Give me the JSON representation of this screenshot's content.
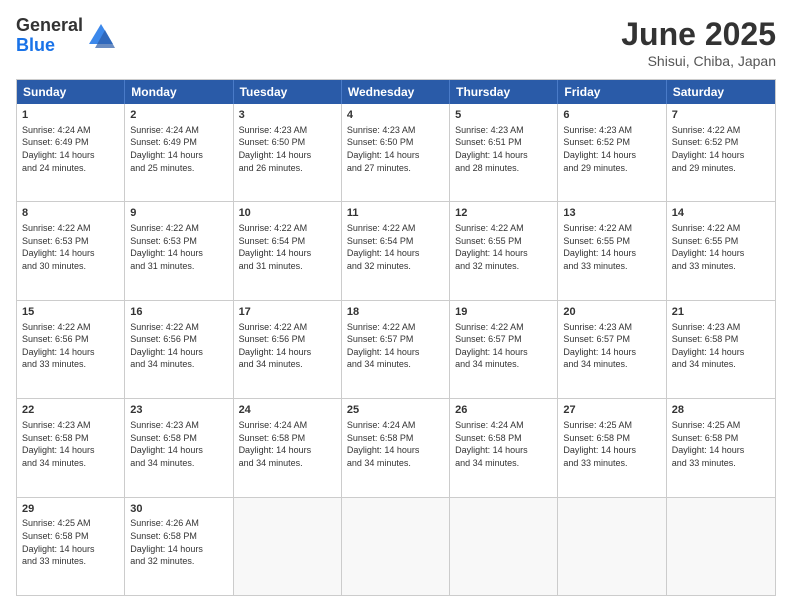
{
  "header": {
    "logo_general": "General",
    "logo_blue": "Blue",
    "month": "June 2025",
    "location": "Shisui, Chiba, Japan"
  },
  "weekdays": [
    "Sunday",
    "Monday",
    "Tuesday",
    "Wednesday",
    "Thursday",
    "Friday",
    "Saturday"
  ],
  "rows": [
    [
      {
        "day": "",
        "lines": [],
        "empty": true
      },
      {
        "day": "2",
        "lines": [
          "Sunrise: 4:24 AM",
          "Sunset: 6:49 PM",
          "Daylight: 14 hours",
          "and 25 minutes."
        ]
      },
      {
        "day": "3",
        "lines": [
          "Sunrise: 4:23 AM",
          "Sunset: 6:50 PM",
          "Daylight: 14 hours",
          "and 26 minutes."
        ]
      },
      {
        "day": "4",
        "lines": [
          "Sunrise: 4:23 AM",
          "Sunset: 6:50 PM",
          "Daylight: 14 hours",
          "and 27 minutes."
        ]
      },
      {
        "day": "5",
        "lines": [
          "Sunrise: 4:23 AM",
          "Sunset: 6:51 PM",
          "Daylight: 14 hours",
          "and 28 minutes."
        ]
      },
      {
        "day": "6",
        "lines": [
          "Sunrise: 4:23 AM",
          "Sunset: 6:52 PM",
          "Daylight: 14 hours",
          "and 29 minutes."
        ]
      },
      {
        "day": "7",
        "lines": [
          "Sunrise: 4:22 AM",
          "Sunset: 6:52 PM",
          "Daylight: 14 hours",
          "and 29 minutes."
        ]
      }
    ],
    [
      {
        "day": "8",
        "lines": [
          "Sunrise: 4:22 AM",
          "Sunset: 6:53 PM",
          "Daylight: 14 hours",
          "and 30 minutes."
        ]
      },
      {
        "day": "9",
        "lines": [
          "Sunrise: 4:22 AM",
          "Sunset: 6:53 PM",
          "Daylight: 14 hours",
          "and 31 minutes."
        ]
      },
      {
        "day": "10",
        "lines": [
          "Sunrise: 4:22 AM",
          "Sunset: 6:54 PM",
          "Daylight: 14 hours",
          "and 31 minutes."
        ]
      },
      {
        "day": "11",
        "lines": [
          "Sunrise: 4:22 AM",
          "Sunset: 6:54 PM",
          "Daylight: 14 hours",
          "and 32 minutes."
        ]
      },
      {
        "day": "12",
        "lines": [
          "Sunrise: 4:22 AM",
          "Sunset: 6:55 PM",
          "Daylight: 14 hours",
          "and 32 minutes."
        ]
      },
      {
        "day": "13",
        "lines": [
          "Sunrise: 4:22 AM",
          "Sunset: 6:55 PM",
          "Daylight: 14 hours",
          "and 33 minutes."
        ]
      },
      {
        "day": "14",
        "lines": [
          "Sunrise: 4:22 AM",
          "Sunset: 6:55 PM",
          "Daylight: 14 hours",
          "and 33 minutes."
        ]
      }
    ],
    [
      {
        "day": "15",
        "lines": [
          "Sunrise: 4:22 AM",
          "Sunset: 6:56 PM",
          "Daylight: 14 hours",
          "and 33 minutes."
        ]
      },
      {
        "day": "16",
        "lines": [
          "Sunrise: 4:22 AM",
          "Sunset: 6:56 PM",
          "Daylight: 14 hours",
          "and 34 minutes."
        ]
      },
      {
        "day": "17",
        "lines": [
          "Sunrise: 4:22 AM",
          "Sunset: 6:56 PM",
          "Daylight: 14 hours",
          "and 34 minutes."
        ]
      },
      {
        "day": "18",
        "lines": [
          "Sunrise: 4:22 AM",
          "Sunset: 6:57 PM",
          "Daylight: 14 hours",
          "and 34 minutes."
        ]
      },
      {
        "day": "19",
        "lines": [
          "Sunrise: 4:22 AM",
          "Sunset: 6:57 PM",
          "Daylight: 14 hours",
          "and 34 minutes."
        ]
      },
      {
        "day": "20",
        "lines": [
          "Sunrise: 4:23 AM",
          "Sunset: 6:57 PM",
          "Daylight: 14 hours",
          "and 34 minutes."
        ]
      },
      {
        "day": "21",
        "lines": [
          "Sunrise: 4:23 AM",
          "Sunset: 6:58 PM",
          "Daylight: 14 hours",
          "and 34 minutes."
        ]
      }
    ],
    [
      {
        "day": "22",
        "lines": [
          "Sunrise: 4:23 AM",
          "Sunset: 6:58 PM",
          "Daylight: 14 hours",
          "and 34 minutes."
        ]
      },
      {
        "day": "23",
        "lines": [
          "Sunrise: 4:23 AM",
          "Sunset: 6:58 PM",
          "Daylight: 14 hours",
          "and 34 minutes."
        ]
      },
      {
        "day": "24",
        "lines": [
          "Sunrise: 4:24 AM",
          "Sunset: 6:58 PM",
          "Daylight: 14 hours",
          "and 34 minutes."
        ]
      },
      {
        "day": "25",
        "lines": [
          "Sunrise: 4:24 AM",
          "Sunset: 6:58 PM",
          "Daylight: 14 hours",
          "and 34 minutes."
        ]
      },
      {
        "day": "26",
        "lines": [
          "Sunrise: 4:24 AM",
          "Sunset: 6:58 PM",
          "Daylight: 14 hours",
          "and 34 minutes."
        ]
      },
      {
        "day": "27",
        "lines": [
          "Sunrise: 4:25 AM",
          "Sunset: 6:58 PM",
          "Daylight: 14 hours",
          "and 33 minutes."
        ]
      },
      {
        "day": "28",
        "lines": [
          "Sunrise: 4:25 AM",
          "Sunset: 6:58 PM",
          "Daylight: 14 hours",
          "and 33 minutes."
        ]
      }
    ],
    [
      {
        "day": "29",
        "lines": [
          "Sunrise: 4:25 AM",
          "Sunset: 6:58 PM",
          "Daylight: 14 hours",
          "and 33 minutes."
        ]
      },
      {
        "day": "30",
        "lines": [
          "Sunrise: 4:26 AM",
          "Sunset: 6:58 PM",
          "Daylight: 14 hours",
          "and 32 minutes."
        ]
      },
      {
        "day": "",
        "lines": [],
        "empty": true
      },
      {
        "day": "",
        "lines": [],
        "empty": true
      },
      {
        "day": "",
        "lines": [],
        "empty": true
      },
      {
        "day": "",
        "lines": [],
        "empty": true
      },
      {
        "day": "",
        "lines": [],
        "empty": true
      }
    ]
  ],
  "row0_day1": {
    "day": "1",
    "lines": [
      "Sunrise: 4:24 AM",
      "Sunset: 6:49 PM",
      "Daylight: 14 hours",
      "and 24 minutes."
    ]
  }
}
